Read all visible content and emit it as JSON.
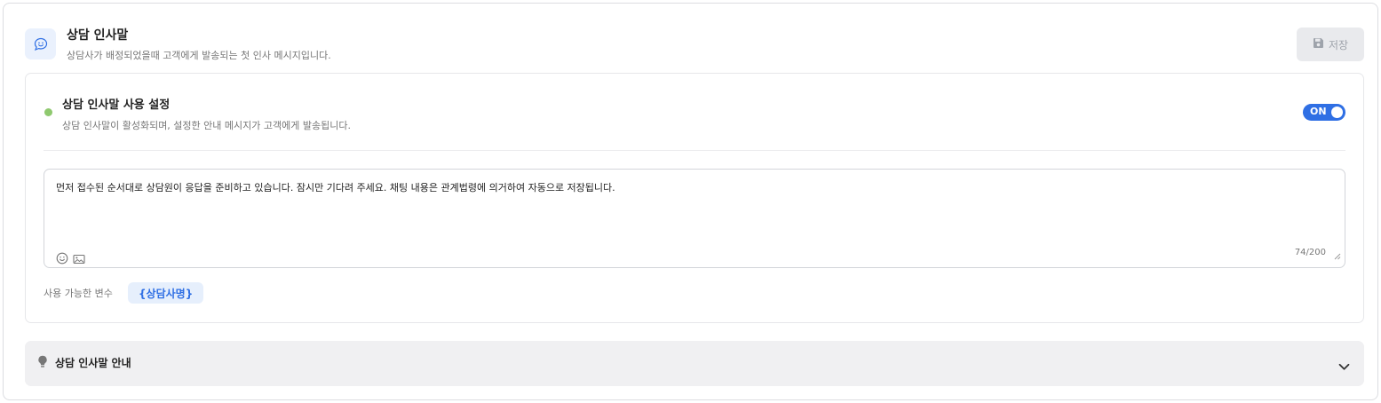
{
  "header": {
    "icon": "chat-bubble-smile-icon",
    "title": "상담 인사말",
    "description": "상담사가 배정되었을때 고객에게 발송되는 첫 인사 메시지입니다.",
    "save_label": "저장",
    "save_icon": "floppy-disk-icon"
  },
  "settings": {
    "status_color": "#8fc96f",
    "title": "상담 인사말 사용 설정",
    "description": "상담 인사말이 활성화되며, 설정한 안내 메시지가 고객에게 발송됩니다.",
    "toggle_label": "ON",
    "toggle_on": true,
    "message": "먼저 접수된 순서대로 상담원이 응답을 준비하고 있습니다. 잠시만 기다려 주세요. 채팅 내용은 관계법령에 의거하여 자동으로 저장됩니다.",
    "char_count": "74/200",
    "toolbar_icons": [
      "emoji-icon",
      "image-icon"
    ],
    "variables_label": "사용 가능한 변수",
    "variables": [
      "{상담사명}"
    ]
  },
  "guide": {
    "icon": "lightbulb-icon",
    "label": "상담 인사말 안내",
    "expanded": false
  },
  "colors": {
    "accent": "#2f6fe4",
    "chip_bg": "#e6effc",
    "guide_bg": "#f0f0f2"
  }
}
